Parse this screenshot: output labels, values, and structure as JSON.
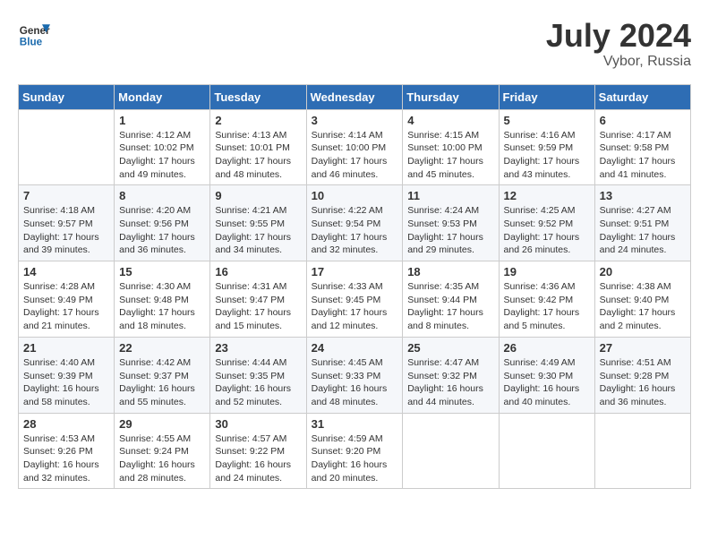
{
  "header": {
    "logo_general": "General",
    "logo_blue": "Blue",
    "month_year": "July 2024",
    "location": "Vybor, Russia"
  },
  "weekdays": [
    "Sunday",
    "Monday",
    "Tuesday",
    "Wednesday",
    "Thursday",
    "Friday",
    "Saturday"
  ],
  "weeks": [
    [
      {
        "day": "",
        "info": ""
      },
      {
        "day": "1",
        "info": "Sunrise: 4:12 AM\nSunset: 10:02 PM\nDaylight: 17 hours\nand 49 minutes."
      },
      {
        "day": "2",
        "info": "Sunrise: 4:13 AM\nSunset: 10:01 PM\nDaylight: 17 hours\nand 48 minutes."
      },
      {
        "day": "3",
        "info": "Sunrise: 4:14 AM\nSunset: 10:00 PM\nDaylight: 17 hours\nand 46 minutes."
      },
      {
        "day": "4",
        "info": "Sunrise: 4:15 AM\nSunset: 10:00 PM\nDaylight: 17 hours\nand 45 minutes."
      },
      {
        "day": "5",
        "info": "Sunrise: 4:16 AM\nSunset: 9:59 PM\nDaylight: 17 hours\nand 43 minutes."
      },
      {
        "day": "6",
        "info": "Sunrise: 4:17 AM\nSunset: 9:58 PM\nDaylight: 17 hours\nand 41 minutes."
      }
    ],
    [
      {
        "day": "7",
        "info": "Sunrise: 4:18 AM\nSunset: 9:57 PM\nDaylight: 17 hours\nand 39 minutes."
      },
      {
        "day": "8",
        "info": "Sunrise: 4:20 AM\nSunset: 9:56 PM\nDaylight: 17 hours\nand 36 minutes."
      },
      {
        "day": "9",
        "info": "Sunrise: 4:21 AM\nSunset: 9:55 PM\nDaylight: 17 hours\nand 34 minutes."
      },
      {
        "day": "10",
        "info": "Sunrise: 4:22 AM\nSunset: 9:54 PM\nDaylight: 17 hours\nand 32 minutes."
      },
      {
        "day": "11",
        "info": "Sunrise: 4:24 AM\nSunset: 9:53 PM\nDaylight: 17 hours\nand 29 minutes."
      },
      {
        "day": "12",
        "info": "Sunrise: 4:25 AM\nSunset: 9:52 PM\nDaylight: 17 hours\nand 26 minutes."
      },
      {
        "day": "13",
        "info": "Sunrise: 4:27 AM\nSunset: 9:51 PM\nDaylight: 17 hours\nand 24 minutes."
      }
    ],
    [
      {
        "day": "14",
        "info": "Sunrise: 4:28 AM\nSunset: 9:49 PM\nDaylight: 17 hours\nand 21 minutes."
      },
      {
        "day": "15",
        "info": "Sunrise: 4:30 AM\nSunset: 9:48 PM\nDaylight: 17 hours\nand 18 minutes."
      },
      {
        "day": "16",
        "info": "Sunrise: 4:31 AM\nSunset: 9:47 PM\nDaylight: 17 hours\nand 15 minutes."
      },
      {
        "day": "17",
        "info": "Sunrise: 4:33 AM\nSunset: 9:45 PM\nDaylight: 17 hours\nand 12 minutes."
      },
      {
        "day": "18",
        "info": "Sunrise: 4:35 AM\nSunset: 9:44 PM\nDaylight: 17 hours\nand 8 minutes."
      },
      {
        "day": "19",
        "info": "Sunrise: 4:36 AM\nSunset: 9:42 PM\nDaylight: 17 hours\nand 5 minutes."
      },
      {
        "day": "20",
        "info": "Sunrise: 4:38 AM\nSunset: 9:40 PM\nDaylight: 17 hours\nand 2 minutes."
      }
    ],
    [
      {
        "day": "21",
        "info": "Sunrise: 4:40 AM\nSunset: 9:39 PM\nDaylight: 16 hours\nand 58 minutes."
      },
      {
        "day": "22",
        "info": "Sunrise: 4:42 AM\nSunset: 9:37 PM\nDaylight: 16 hours\nand 55 minutes."
      },
      {
        "day": "23",
        "info": "Sunrise: 4:44 AM\nSunset: 9:35 PM\nDaylight: 16 hours\nand 52 minutes."
      },
      {
        "day": "24",
        "info": "Sunrise: 4:45 AM\nSunset: 9:33 PM\nDaylight: 16 hours\nand 48 minutes."
      },
      {
        "day": "25",
        "info": "Sunrise: 4:47 AM\nSunset: 9:32 PM\nDaylight: 16 hours\nand 44 minutes."
      },
      {
        "day": "26",
        "info": "Sunrise: 4:49 AM\nSunset: 9:30 PM\nDaylight: 16 hours\nand 40 minutes."
      },
      {
        "day": "27",
        "info": "Sunrise: 4:51 AM\nSunset: 9:28 PM\nDaylight: 16 hours\nand 36 minutes."
      }
    ],
    [
      {
        "day": "28",
        "info": "Sunrise: 4:53 AM\nSunset: 9:26 PM\nDaylight: 16 hours\nand 32 minutes."
      },
      {
        "day": "29",
        "info": "Sunrise: 4:55 AM\nSunset: 9:24 PM\nDaylight: 16 hours\nand 28 minutes."
      },
      {
        "day": "30",
        "info": "Sunrise: 4:57 AM\nSunset: 9:22 PM\nDaylight: 16 hours\nand 24 minutes."
      },
      {
        "day": "31",
        "info": "Sunrise: 4:59 AM\nSunset: 9:20 PM\nDaylight: 16 hours\nand 20 minutes."
      },
      {
        "day": "",
        "info": ""
      },
      {
        "day": "",
        "info": ""
      },
      {
        "day": "",
        "info": ""
      }
    ]
  ]
}
